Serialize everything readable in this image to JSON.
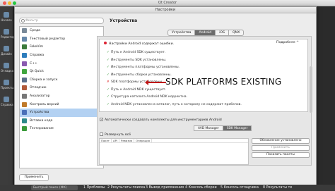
{
  "window": {
    "title": "Qt Creator"
  },
  "dialog": {
    "title": "Настройки",
    "filter_placeholder": "Фильтр",
    "apply_label": "Применить",
    "categories": [
      {
        "label": "Среда",
        "color": "#7a8a99"
      },
      {
        "label": "Текстовый редактор",
        "color": "#6688aa"
      },
      {
        "label": "FakeVim",
        "color": "#3b7a3b"
      },
      {
        "label": "Справка",
        "color": "#2e7dbd"
      },
      {
        "label": "C++",
        "color": "#8a5ab0"
      },
      {
        "label": "Qt Quick",
        "color": "#41a63f"
      },
      {
        "label": "Сборка и запуск",
        "color": "#5a6e8a"
      },
      {
        "label": "Отладчик",
        "color": "#b05a3a"
      },
      {
        "label": "Анализатор",
        "color": "#777777"
      },
      {
        "label": "Контроль версий",
        "color": "#c07a2a"
      },
      {
        "label": "Устройства",
        "color": "#4a70b8"
      },
      {
        "label": "Вставка кода",
        "color": "#2e8a8a"
      },
      {
        "label": "Тестирование",
        "color": "#3a9a3a"
      }
    ],
    "selected_category_index": 10
  },
  "devices_pane": {
    "title": "Устройства",
    "tabs": [
      "Устройства",
      "Android",
      "iOS",
      "QNX"
    ],
    "active_tab": 1,
    "status_header": "Настройки Android содержат ошибки.",
    "details_label": "Подробнее",
    "checks": [
      {
        "text": "Путь к Android SDK существует.",
        "ok": true
      },
      {
        "text": "Инструменты SDK установлены.",
        "ok": true
      },
      {
        "text": "Инструменты платформы установлены.",
        "ok": true
      },
      {
        "text": "Инструменты сборки установлены.",
        "ok": true
      },
      {
        "text": "SDK платформы установлены.",
        "ok": false
      },
      {
        "text": "Путь к Android NDK существует.",
        "ok": true
      },
      {
        "text": "Структура каталога Android NDK корректна.",
        "ok": true
      },
      {
        "text": "Android NDK установлен в каталог, путь к которому не содержит пробелов.",
        "ok": true
      }
    ],
    "annotation_text": "SDK PLATFORMS EXISTING",
    "auto_kits_label": "Автоматически создавать комплекты для инструментариев Android",
    "auto_kits_checked": true,
    "sub_tabs": [
      "AVD Manager",
      "SDK Manager"
    ],
    "active_sub_tab": 1,
    "expand_all_label": "Развернуть всё",
    "table_columns": [
      "Пакет",
      "API",
      "Ревизия",
      "Операция"
    ],
    "side_buttons": [
      {
        "label": "Обновление установлено",
        "enabled": true
      },
      {
        "label": "Применить",
        "enabled": false
      },
      {
        "label": "Показать пакеты",
        "enabled": true
      }
    ]
  },
  "left_rail": {
    "items": [
      "Начало",
      "Редактор",
      "Дизайн",
      "Отладка",
      "Проекты",
      "Справка"
    ]
  },
  "bottom_bar": {
    "search_placeholder": "Быстрый поиск (⌘K)",
    "items": [
      "1 Проблемы",
      "2 Результаты поиска",
      "3 Вывод приложения",
      "4 Консоль сборки",
      "5 Консоль отладчика",
      "8 Результаты те"
    ]
  },
  "colors": {
    "accent": "#6c6c6c",
    "selection": "#b3d1f2",
    "error": "#d22222",
    "ok": "#3a9a3a",
    "arrow": "#c01818"
  }
}
